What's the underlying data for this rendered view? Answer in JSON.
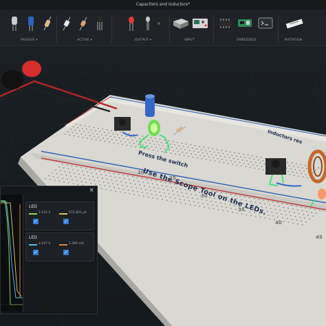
{
  "window": {
    "title": "Capacitors and Inductors*"
  },
  "toolbar": {
    "groups": [
      {
        "label": "PASSIVE ▾"
      },
      {
        "label": "ACTIVE ▾"
      },
      {
        "label": "OUTPUT ▾"
      },
      {
        "label": "INPUT"
      },
      {
        "label": "EMBEDDED"
      },
      {
        "label": "NOTATION"
      }
    ],
    "tools": [
      "capacitor-icon",
      "resistor-icon",
      "resistor-icon",
      "resistor-icon",
      "resistor-icon",
      "transistor-icon",
      "led-icon",
      "diode-icon",
      "buzzer-icon",
      "battery-icon",
      "power-supply-icon",
      "ic-chip-icon",
      "arduino-icon",
      "terminal-icon",
      "label-icon"
    ]
  },
  "scene": {
    "instruction_main": "Use the Scope Tool on the LEDs.",
    "note_left": "Press the switch",
    "note_right": "Inductors res",
    "grid_numbers": [
      "20",
      "25",
      "30",
      "35",
      "40",
      "45"
    ]
  },
  "scope": {
    "cards": [
      {
        "title": "LED",
        "voltage": "2.152 V",
        "current": "572.801 µA",
        "voltage_color": "#9bd36a",
        "current_color": "#d8c15a"
      },
      {
        "title": "LED",
        "voltage": "2.227 V",
        "current": "1.366 mA",
        "voltage_color": "#58b9e8",
        "current_color": "#d8844a"
      }
    ]
  },
  "colors": {
    "accent": "#2e7fd6",
    "breadboard": "#d9d8d2",
    "rail_red": "#c0393b",
    "rail_blue": "#2f5fb0"
  }
}
